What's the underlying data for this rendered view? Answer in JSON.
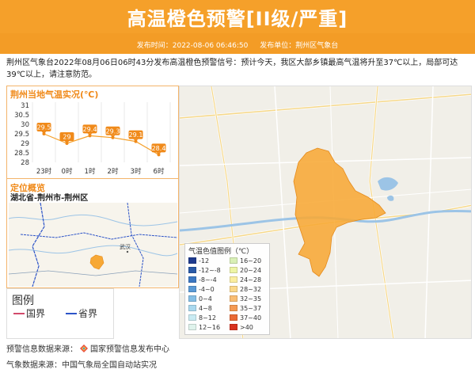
{
  "banner": {
    "title": "高温橙色预警[II级/严重]"
  },
  "subbar": {
    "time": "发布时间：2022-08-06 06:46:50",
    "unit": "发布单位：荆州区气象台"
  },
  "description": "荆州区气象台2022年08月06日06时43分发布高温橙色预警信号：预计今天，我区大部乡镇最高气温将升至37℃以上，局部可达39℃以上，请注意防范。",
  "temp_panel": {
    "title": "荆州当地气温实况(℃)"
  },
  "location_panel": {
    "title": "定位概览",
    "path": "湖北省-荆州市-荆州区"
  },
  "boundary_legend": {
    "title": "图例",
    "items": [
      "国界",
      "省界"
    ],
    "colors": [
      "#d24a6b",
      "#2d54c8"
    ]
  },
  "color_legend": {
    "title": "气温色值图例（℃）",
    "items": [
      {
        "label": "-12",
        "color": "#1f3b8f"
      },
      {
        "label": "-12~-8",
        "color": "#2a5aa8"
      },
      {
        "label": "-8~-4",
        "color": "#3b77c2"
      },
      {
        "label": "-4~0",
        "color": "#5a9ad6"
      },
      {
        "label": "0~4",
        "color": "#85bfe6"
      },
      {
        "label": "4~8",
        "color": "#aad9ef"
      },
      {
        "label": "8~12",
        "color": "#c9ebf3"
      },
      {
        "label": "12~16",
        "color": "#dff3ec"
      },
      {
        "label": "16~20",
        "color": "#d9f0b6"
      },
      {
        "label": "20~24",
        "color": "#eef5a6"
      },
      {
        "label": "24~28",
        "color": "#fbeea0"
      },
      {
        "label": "28~32",
        "color": "#fbd88a"
      },
      {
        "label": "32~35",
        "color": "#f9bd72"
      },
      {
        "label": "35~37",
        "color": "#f49a52"
      },
      {
        "label": "37~40",
        "color": "#ea6a35"
      },
      {
        "label": ">40",
        "color": "#d8321f"
      }
    ]
  },
  "map_labels": {
    "wuhan": "武汉"
  },
  "footer": {
    "warning_source_label": "预警信息数据来源：",
    "warning_source": "国家预警信息发布中心",
    "weather_source": "气象数据来源：中国气象局全国自动站实况"
  },
  "colors": {
    "accent": "#f5a02a",
    "warning_area": "#f7a835",
    "title_orange": "#f08a1a"
  },
  "chart_data": {
    "type": "line",
    "categories": [
      "23时",
      "0时",
      "1时",
      "2时",
      "3时",
      "6时"
    ],
    "values": [
      29.5,
      29,
      29.4,
      29.3,
      29.1,
      28.4
    ],
    "yticks": [
      "31",
      "30.5",
      "30",
      "29.5",
      "29",
      "28.5",
      "28"
    ],
    "ylim": [
      28,
      31
    ],
    "grid": "vertical"
  }
}
